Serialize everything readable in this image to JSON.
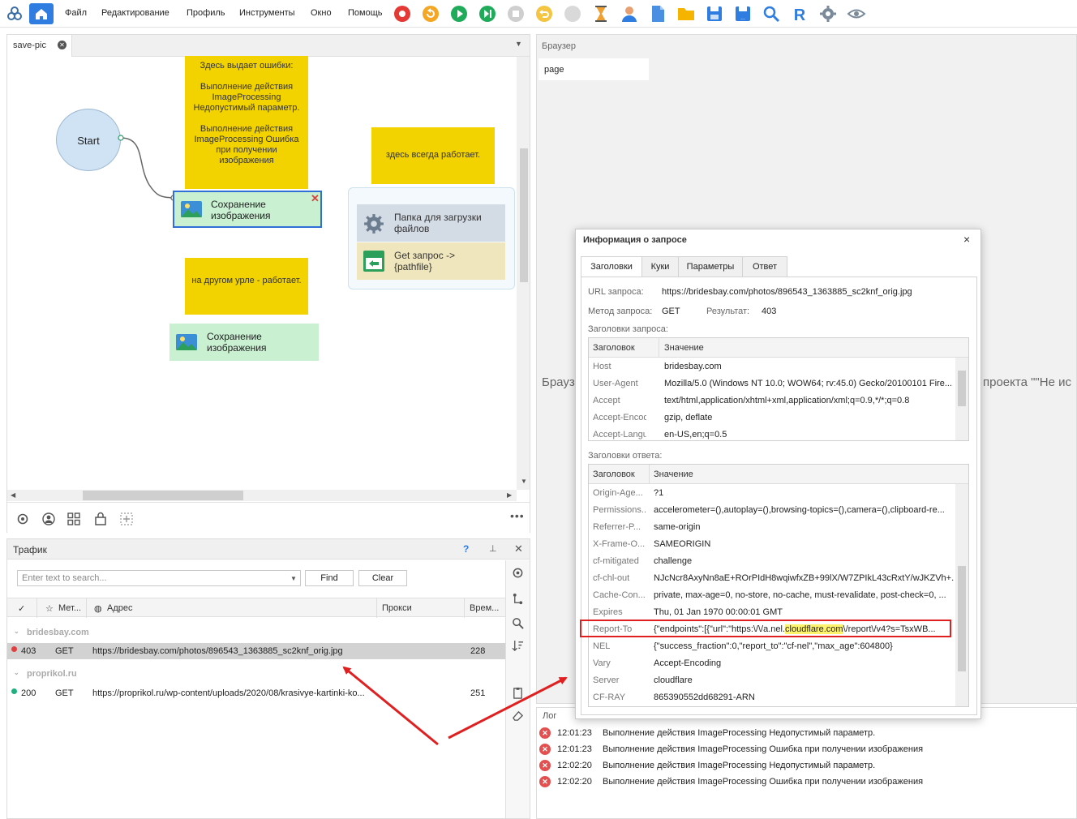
{
  "menu": {
    "file": "Файл",
    "edit": "Редактирование",
    "profile": "Профиль",
    "tools": "Инструменты",
    "window": "Окно",
    "help": "Помощь"
  },
  "toolbar_icons": [
    "logo-icon",
    "home-icon",
    "record-icon",
    "refresh-icon",
    "play-icon",
    "step-icon",
    "stop-icon",
    "undo-icon",
    "circle-icon",
    "hourglass-icon",
    "user-icon",
    "document-icon",
    "folder-icon",
    "save-icon",
    "save-as-icon",
    "search-icon",
    "r-icon",
    "gear-icon",
    "eye-icon"
  ],
  "editor": {
    "tab_label": "save-pic",
    "note1": "Здесь выдает ошибки:\n\nВыполнение действия ImageProcessing Недопустимый параметр.\n\nВыполнение действия ImageProcessing Ошибка при получении изображения",
    "note2": "здесь всегда работает.",
    "note3": "на другом урле - работает.",
    "start_label": "Start",
    "action1_label": "Сохранение\nизображения",
    "action2_label": "Сохранение\nизображения",
    "group_item1_label": "Папка для загрузки\nфайлов",
    "group_item2_label": "Get запрос ->\n{pathfile}"
  },
  "traffic": {
    "title": "Трафик",
    "help": "?",
    "search_placeholder": "Enter text to search...",
    "find_label": "Find",
    "clear_label": "Clear",
    "columns": {
      "method": "Мет...",
      "address": "Адрес",
      "proxy": "Прокси",
      "time": "Врем..."
    },
    "groups": [
      {
        "name": "bridesbay.com",
        "rows": [
          {
            "status": "403",
            "method": "GET",
            "url": "https://bridesbay.com/photos/896543_1363885_sc2knf_orig.jpg",
            "time": "228",
            "dot_color": "#e04040"
          }
        ]
      },
      {
        "name": "proprikol.ru",
        "rows": [
          {
            "status": "200",
            "method": "GET",
            "url": "https://proprikol.ru/wp-content/uploads/2020/08/krasivye-kartinki-ko...",
            "time": "251",
            "dot_color": "#20b080"
          }
        ]
      }
    ]
  },
  "browser": {
    "title": "Браузер",
    "tab_label": "page",
    "bg_text_left": "Брауз",
    "bg_text_right": "проекта \"\"Не ис"
  },
  "log": {
    "title": "Лог",
    "entries": [
      {
        "time": "12:01:23",
        "msg": "Выполнение действия ImageProcessing Недопустимый параметр."
      },
      {
        "time": "12:01:23",
        "msg": "Выполнение действия ImageProcessing Ошибка при получении изображения"
      },
      {
        "time": "12:02:20",
        "msg": "Выполнение действия ImageProcessing Недопустимый параметр."
      },
      {
        "time": "12:02:20",
        "msg": "Выполнение действия ImageProcessing Ошибка при получении изображения"
      }
    ]
  },
  "dialog": {
    "title": "Информация о запросе",
    "close": "×",
    "tabs": [
      "Заголовки",
      "Куки",
      "Параметры",
      "Ответ"
    ],
    "url_label": "URL запроса:",
    "url_value": "https://bridesbay.com/photos/896543_1363885_sc2knf_orig.jpg",
    "method_label": "Метод запроса:",
    "method_value": "GET",
    "result_label": "Результат:",
    "result_value": "403",
    "req_headers_label": "Заголовки запроса:",
    "resp_headers_label": "Заголовки ответа:",
    "col_header": "Заголовок",
    "col_value": "Значение",
    "request_headers": [
      {
        "k": "Host",
        "v": "bridesbay.com"
      },
      {
        "k": "User-Agent",
        "v": "Mozilla/5.0 (Windows NT 10.0; WOW64; rv:45.0) Gecko/20100101 Fire..."
      },
      {
        "k": "Accept",
        "v": "text/html,application/xhtml+xml,application/xml;q=0.9,*/*;q=0.8"
      },
      {
        "k": "Accept-Encodi...",
        "v": "gzip, deflate"
      },
      {
        "k": "Accept-Langu...",
        "v": "en-US,en;q=0.5"
      }
    ],
    "response_headers": [
      {
        "k": "Origin-Age...",
        "v": "?1"
      },
      {
        "k": "Permissions...",
        "v": "accelerometer=(),autoplay=(),browsing-topics=(),camera=(),clipboard-re..."
      },
      {
        "k": "Referrer-P...",
        "v": "same-origin"
      },
      {
        "k": "X-Frame-O...",
        "v": "SAMEORIGIN"
      },
      {
        "k": "cf-mitigated",
        "v": "challenge"
      },
      {
        "k": "cf-chl-out",
        "v": "NJcNcr8AxyNn8aE+ROrPIdH8wqiwfxZB+99lX/W7ZPIkL43cRxtY/wJKZVh+..."
      },
      {
        "k": "Cache-Con...",
        "v": "private, max-age=0, no-store, no-cache, must-revalidate, post-check=0, ..."
      },
      {
        "k": "Expires",
        "v": "Thu, 01 Jan 1970 00:00:01 GMT"
      },
      {
        "k": "Report-To",
        "v_pre": "{\"endpoints\":[{\"url\":\"https:\\/\\/a.nel.",
        "v_hl": "cloudflare.com",
        "v_post": "\\/report\\/v4?s=TsxWB..."
      },
      {
        "k": "NEL",
        "v": "{\"success_fraction\":0,\"report_to\":\"cf-nel\",\"max_age\":604800}"
      },
      {
        "k": "Vary",
        "v": "Accept-Encoding"
      },
      {
        "k": "Server",
        "v": "cloudflare"
      },
      {
        "k": "CF-RAY",
        "v": "865390552dd68291-ARN"
      }
    ]
  },
  "colors": {
    "note": "#f2d300",
    "action": "#c8f0d1",
    "start": "#cfe3f5",
    "highlight_box": "#e02020",
    "arrow": "#e02020"
  }
}
